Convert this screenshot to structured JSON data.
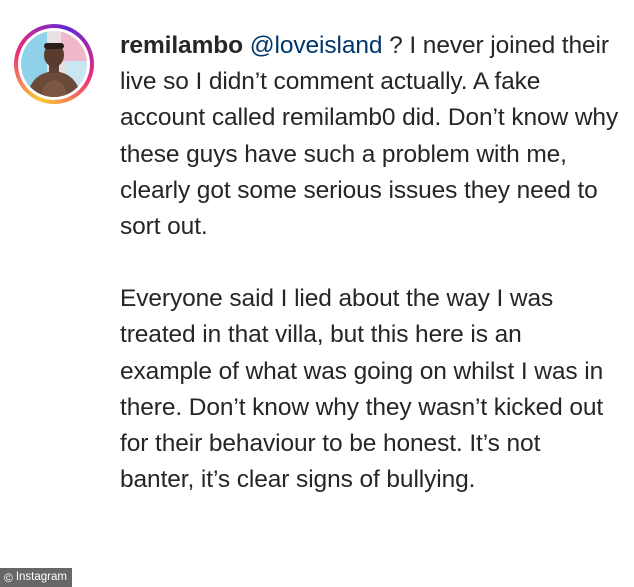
{
  "comment": {
    "avatar_icon": "user-avatar-photo",
    "username": "remilambo",
    "mention": "@loveisland",
    "text_p1": " ? I never joined their live so I didn’t comment actually. A fake account called remilamb0 did. Don’t know why these guys have such a problem with me, clearly got some serious issues they need to sort out.",
    "text_p2": "Everyone said I lied about the way I was treated in that villa, but this here is an example of what was going on whilst I was in there. Don’t know why they wasn’t kicked out for their behaviour to be honest. It’s not banter, it’s clear signs of bullying."
  },
  "credit": {
    "icon": "copyright-icon",
    "symbol": "©",
    "label": "Instagram"
  },
  "colors": {
    "text": "#262626",
    "mention": "#00376b",
    "ring": [
      "#f9ce34",
      "#ee2a7b",
      "#6228d7"
    ]
  }
}
